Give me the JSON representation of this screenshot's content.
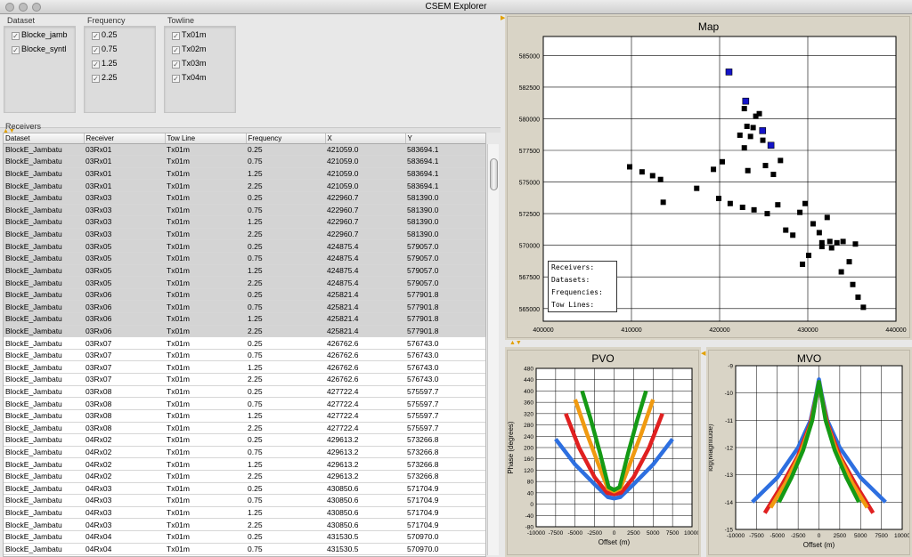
{
  "window": {
    "title": "CSEM Explorer"
  },
  "filters": {
    "dataset": {
      "label": "Dataset",
      "items": [
        {
          "label": "Blocke_jamb",
          "checked": true
        },
        {
          "label": "Blocke_syntl",
          "checked": true
        }
      ]
    },
    "frequency": {
      "label": "Frequency",
      "items": [
        {
          "label": "0.25",
          "checked": true
        },
        {
          "label": "0.75",
          "checked": true
        },
        {
          "label": "1.25",
          "checked": true
        },
        {
          "label": "2.25",
          "checked": true
        }
      ]
    },
    "towline": {
      "label": "Towline",
      "items": [
        {
          "label": "Tx01m",
          "checked": true
        },
        {
          "label": "Tx02m",
          "checked": true
        },
        {
          "label": "Tx03m",
          "checked": true
        },
        {
          "label": "Tx04m",
          "checked": true
        }
      ]
    }
  },
  "receivers": {
    "label": "Receivers",
    "columns": [
      "Dataset",
      "Receiver",
      "Tow Line",
      "Frequency",
      "X",
      "Y"
    ],
    "rows": [
      [
        "BlockE_Jambatu",
        "03Rx01",
        "Tx01m",
        "0.25",
        "421059.0",
        "583694.1"
      ],
      [
        "BlockE_Jambatu",
        "03Rx01",
        "Tx01m",
        "0.75",
        "421059.0",
        "583694.1"
      ],
      [
        "BlockE_Jambatu",
        "03Rx01",
        "Tx01m",
        "1.25",
        "421059.0",
        "583694.1"
      ],
      [
        "BlockE_Jambatu",
        "03Rx01",
        "Tx01m",
        "2.25",
        "421059.0",
        "583694.1"
      ],
      [
        "BlockE_Jambatu",
        "03Rx03",
        "Tx01m",
        "0.25",
        "422960.7",
        "581390.0"
      ],
      [
        "BlockE_Jambatu",
        "03Rx03",
        "Tx01m",
        "0.75",
        "422960.7",
        "581390.0"
      ],
      [
        "BlockE_Jambatu",
        "03Rx03",
        "Tx01m",
        "1.25",
        "422960.7",
        "581390.0"
      ],
      [
        "BlockE_Jambatu",
        "03Rx03",
        "Tx01m",
        "2.25",
        "422960.7",
        "581390.0"
      ],
      [
        "BlockE_Jambatu",
        "03Rx05",
        "Tx01m",
        "0.25",
        "424875.4",
        "579057.0"
      ],
      [
        "BlockE_Jambatu",
        "03Rx05",
        "Tx01m",
        "0.75",
        "424875.4",
        "579057.0"
      ],
      [
        "BlockE_Jambatu",
        "03Rx05",
        "Tx01m",
        "1.25",
        "424875.4",
        "579057.0"
      ],
      [
        "BlockE_Jambatu",
        "03Rx05",
        "Tx01m",
        "2.25",
        "424875.4",
        "579057.0"
      ],
      [
        "BlockE_Jambatu",
        "03Rx06",
        "Tx01m",
        "0.25",
        "425821.4",
        "577901.8"
      ],
      [
        "BlockE_Jambatu",
        "03Rx06",
        "Tx01m",
        "0.75",
        "425821.4",
        "577901.8"
      ],
      [
        "BlockE_Jambatu",
        "03Rx06",
        "Tx01m",
        "1.25",
        "425821.4",
        "577901.8"
      ],
      [
        "BlockE_Jambatu",
        "03Rx06",
        "Tx01m",
        "2.25",
        "425821.4",
        "577901.8"
      ],
      [
        "BlockE_Jambatu",
        "03Rx07",
        "Tx01m",
        "0.25",
        "426762.6",
        "576743.0"
      ],
      [
        "BlockE_Jambatu",
        "03Rx07",
        "Tx01m",
        "0.75",
        "426762.6",
        "576743.0"
      ],
      [
        "BlockE_Jambatu",
        "03Rx07",
        "Tx01m",
        "1.25",
        "426762.6",
        "576743.0"
      ],
      [
        "BlockE_Jambatu",
        "03Rx07",
        "Tx01m",
        "2.25",
        "426762.6",
        "576743.0"
      ],
      [
        "BlockE_Jambatu",
        "03Rx08",
        "Tx01m",
        "0.25",
        "427722.4",
        "575597.7"
      ],
      [
        "BlockE_Jambatu",
        "03Rx08",
        "Tx01m",
        "0.75",
        "427722.4",
        "575597.7"
      ],
      [
        "BlockE_Jambatu",
        "03Rx08",
        "Tx01m",
        "1.25",
        "427722.4",
        "575597.7"
      ],
      [
        "BlockE_Jambatu",
        "03Rx08",
        "Tx01m",
        "2.25",
        "427722.4",
        "575597.7"
      ],
      [
        "BlockE_Jambatu",
        "04Rx02",
        "Tx01m",
        "0.25",
        "429613.2",
        "573266.8"
      ],
      [
        "BlockE_Jambatu",
        "04Rx02",
        "Tx01m",
        "0.75",
        "429613.2",
        "573266.8"
      ],
      [
        "BlockE_Jambatu",
        "04Rx02",
        "Tx01m",
        "1.25",
        "429613.2",
        "573266.8"
      ],
      [
        "BlockE_Jambatu",
        "04Rx02",
        "Tx01m",
        "2.25",
        "429613.2",
        "573266.8"
      ],
      [
        "BlockE_Jambatu",
        "04Rx03",
        "Tx01m",
        "0.25",
        "430850.6",
        "571704.9"
      ],
      [
        "BlockE_Jambatu",
        "04Rx03",
        "Tx01m",
        "0.75",
        "430850.6",
        "571704.9"
      ],
      [
        "BlockE_Jambatu",
        "04Rx03",
        "Tx01m",
        "1.25",
        "430850.6",
        "571704.9"
      ],
      [
        "BlockE_Jambatu",
        "04Rx03",
        "Tx01m",
        "2.25",
        "430850.6",
        "571704.9"
      ],
      [
        "BlockE_Jambatu",
        "04Rx04",
        "Tx01m",
        "0.25",
        "431530.5",
        "570970.0"
      ],
      [
        "BlockE_Jambatu",
        "04Rx04",
        "Tx01m",
        "0.75",
        "431530.5",
        "570970.0"
      ]
    ],
    "selected_rows": 16
  },
  "map": {
    "title": "Map",
    "xlim": [
      400000,
      440000
    ],
    "ylim": [
      564000,
      586500
    ],
    "xticks": [
      "400000",
      "410000",
      "420000",
      "430000",
      "440000"
    ],
    "yticks": [
      "565000",
      "567500",
      "570000",
      "572500",
      "575000",
      "577500",
      "580000",
      "582500",
      "585000"
    ],
    "legend": [
      "Receivers:",
      "Datasets:",
      "Frequencies:",
      "Tow Lines:"
    ],
    "colors": {
      "receiver": "#000000",
      "selected": "#1414c8"
    },
    "receivers": [
      [
        409800,
        576200
      ],
      [
        411200,
        575800
      ],
      [
        412400,
        575500
      ],
      [
        413300,
        575200
      ],
      [
        413600,
        573400
      ],
      [
        417400,
        574500
      ],
      [
        419300,
        576000
      ],
      [
        420300,
        576600
      ],
      [
        422300,
        578700
      ],
      [
        422800,
        577700
      ],
      [
        422800,
        580800
      ],
      [
        423100,
        579400
      ],
      [
        423500,
        578600
      ],
      [
        423800,
        579300
      ],
      [
        424100,
        580200
      ],
      [
        424500,
        580400
      ],
      [
        424900,
        578300
      ],
      [
        423200,
        575900
      ],
      [
        425200,
        576300
      ],
      [
        426100,
        575600
      ],
      [
        426900,
        576700
      ],
      [
        426600,
        573200
      ],
      [
        427500,
        571200
      ],
      [
        428300,
        570800
      ],
      [
        429100,
        572600
      ],
      [
        429700,
        573300
      ],
      [
        430600,
        571700
      ],
      [
        431300,
        571000
      ],
      [
        432200,
        572200
      ],
      [
        432700,
        569800
      ],
      [
        433300,
        570200
      ],
      [
        434000,
        570300
      ],
      [
        431600,
        570200
      ],
      [
        435400,
        570100
      ],
      [
        434700,
        568700
      ],
      [
        429400,
        568500
      ],
      [
        430100,
        569200
      ],
      [
        431600,
        569900
      ],
      [
        432500,
        570300
      ],
      [
        433800,
        567900
      ],
      [
        435100,
        566900
      ],
      [
        435700,
        565900
      ],
      [
        436300,
        565100
      ],
      [
        419900,
        573700
      ],
      [
        421200,
        573300
      ],
      [
        422600,
        573000
      ],
      [
        423900,
        572800
      ],
      [
        425400,
        572500
      ]
    ],
    "selected_receivers": [
      [
        421059,
        583694
      ],
      [
        422961,
        581390
      ],
      [
        424875,
        579057
      ],
      [
        425821,
        577902
      ]
    ]
  },
  "pvo": {
    "title": "PVO",
    "xlabel": "Offset (m)",
    "ylabel": "Phase (degrees)",
    "xlim": [
      -10000,
      10000
    ],
    "ylim": [
      -80,
      480
    ],
    "xticks": [
      "-10000",
      "-7500",
      "-5000",
      "-2500",
      "0",
      "2500",
      "5000",
      "7500",
      "10000"
    ],
    "yticks": [
      "-80",
      "-40",
      "0",
      "40",
      "80",
      "120",
      "160",
      "200",
      "240",
      "280",
      "320",
      "360",
      "400",
      "440",
      "480"
    ],
    "series": [
      {
        "color": "#2d6fe0",
        "points": [
          [
            -7500,
            230
          ],
          [
            -5000,
            140
          ],
          [
            -2500,
            70
          ],
          [
            -800,
            25
          ],
          [
            0,
            20
          ],
          [
            800,
            25
          ],
          [
            2500,
            70
          ],
          [
            5000,
            140
          ],
          [
            7500,
            230
          ]
        ]
      },
      {
        "color": "#e02020",
        "points": [
          [
            -6200,
            320
          ],
          [
            -4500,
            200
          ],
          [
            -2500,
            95
          ],
          [
            -900,
            40
          ],
          [
            0,
            35
          ],
          [
            900,
            40
          ],
          [
            2500,
            95
          ],
          [
            4500,
            200
          ],
          [
            6200,
            320
          ]
        ]
      },
      {
        "color": "#f09a10",
        "points": [
          [
            -5000,
            370
          ],
          [
            -3500,
            250
          ],
          [
            -2000,
            140
          ],
          [
            -800,
            55
          ],
          [
            0,
            45
          ],
          [
            800,
            55
          ],
          [
            2000,
            140
          ],
          [
            3500,
            250
          ],
          [
            5000,
            370
          ]
        ]
      },
      {
        "color": "#159a15",
        "points": [
          [
            -4100,
            400
          ],
          [
            -3000,
            300
          ],
          [
            -1800,
            180
          ],
          [
            -700,
            60
          ],
          [
            0,
            50
          ],
          [
            700,
            60
          ],
          [
            1800,
            180
          ],
          [
            3000,
            300
          ],
          [
            4100,
            400
          ]
        ]
      }
    ]
  },
  "mvo": {
    "title": "MVO",
    "xlabel": "Offset (m)",
    "ylabel": "log(Magnitude)",
    "xlim": [
      -10000,
      10000
    ],
    "ylim": [
      -15,
      -9
    ],
    "xticks": [
      "-10000",
      "-7500",
      "-5000",
      "-2500",
      "0",
      "2500",
      "5000",
      "7500",
      "10000"
    ],
    "yticks": [
      "-9",
      "-10",
      "-11",
      "-12",
      "-13",
      "-14",
      "-15"
    ],
    "series": [
      {
        "color": "#2d6fe0",
        "points": [
          [
            -8000,
            -14
          ],
          [
            -5000,
            -13.1
          ],
          [
            -2500,
            -12.0
          ],
          [
            -1000,
            -11.0
          ],
          [
            -300,
            -10.0
          ],
          [
            0,
            -9.5
          ],
          [
            300,
            -10.0
          ],
          [
            1000,
            -11.0
          ],
          [
            2500,
            -12.0
          ],
          [
            5000,
            -13.1
          ],
          [
            8000,
            -14
          ]
        ]
      },
      {
        "color": "#e02020",
        "points": [
          [
            -6500,
            -14.4
          ],
          [
            -4500,
            -13.4
          ],
          [
            -2500,
            -12.3
          ],
          [
            -1000,
            -11.1
          ],
          [
            -300,
            -10.1
          ],
          [
            0,
            -9.6
          ],
          [
            300,
            -10.1
          ],
          [
            1000,
            -11.1
          ],
          [
            2500,
            -12.3
          ],
          [
            4500,
            -13.4
          ],
          [
            6500,
            -14.4
          ]
        ]
      },
      {
        "color": "#f09a10",
        "points": [
          [
            -5800,
            -14.2
          ],
          [
            -4000,
            -13.3
          ],
          [
            -2200,
            -12.2
          ],
          [
            -900,
            -11.1
          ],
          [
            -300,
            -10.1
          ],
          [
            0,
            -9.6
          ],
          [
            300,
            -10.1
          ],
          [
            900,
            -11.1
          ],
          [
            2200,
            -12.2
          ],
          [
            4000,
            -13.3
          ],
          [
            5800,
            -14.2
          ]
        ]
      },
      {
        "color": "#159a15",
        "points": [
          [
            -4800,
            -14.0
          ],
          [
            -3300,
            -13.1
          ],
          [
            -1900,
            -12.1
          ],
          [
            -800,
            -11.0
          ],
          [
            -300,
            -10.1
          ],
          [
            0,
            -9.6
          ],
          [
            300,
            -10.1
          ],
          [
            800,
            -11.0
          ],
          [
            1900,
            -12.1
          ],
          [
            3300,
            -13.1
          ],
          [
            4800,
            -14.0
          ]
        ]
      }
    ]
  }
}
